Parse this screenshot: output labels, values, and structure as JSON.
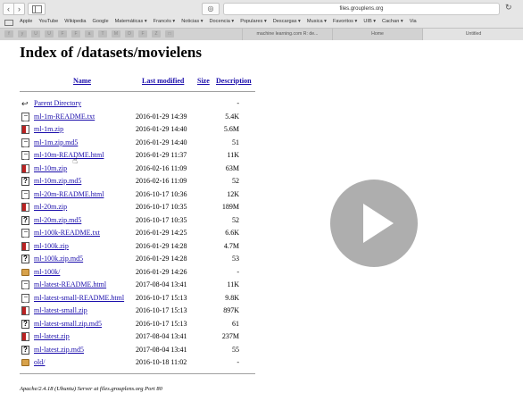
{
  "browser": {
    "address": "files.grouplens.org",
    "bookmarks": [
      "Apple",
      "YouTube",
      "Wikipedia",
      "Google",
      "Matemáticas ▾",
      "Francés ▾",
      "Noticias ▾",
      "Docencia ▾",
      "Populares ▾",
      "Descargas ▾",
      "Musica ▾",
      "Favoritos ▾",
      "UIB ▾",
      "Cachan ▾",
      "Via"
    ],
    "tab_icons": [
      "f",
      "y",
      "U",
      "U",
      "F",
      "F",
      "a",
      "T",
      "M",
      "D",
      "F",
      "Z",
      "□"
    ],
    "tabs": [
      "machine learning.com R: de...",
      "Home",
      "Untitled"
    ]
  },
  "page": {
    "title": "Index of /datasets/movielens",
    "columns": {
      "name": "Name",
      "last_modified": "Last modified",
      "size": "Size",
      "description": "Description"
    },
    "rows": [
      {
        "icon": "back",
        "name": "Parent Directory",
        "modified": "",
        "size": "-"
      },
      {
        "icon": "text",
        "name": "ml-1m-README.txt",
        "modified": "2016-01-29 14:39",
        "size": "5.4K"
      },
      {
        "icon": "zip",
        "name": "ml-1m.zip",
        "modified": "2016-01-29 14:40",
        "size": "5.6M"
      },
      {
        "icon": "text",
        "name": "ml-1m.zip.md5",
        "modified": "2016-01-29 14:40",
        "size": "51"
      },
      {
        "icon": "text",
        "name": "ml-10m-README.html",
        "modified": "2016-01-29 11:37",
        "size": "11K"
      },
      {
        "icon": "zip",
        "name": "ml-10m.zip",
        "modified": "2016-02-16 11:09",
        "size": "63M"
      },
      {
        "icon": "unknown",
        "name": "ml-10m.zip.md5",
        "modified": "2016-02-16 11:09",
        "size": "52"
      },
      {
        "icon": "text",
        "name": "ml-20m-README.html",
        "modified": "2016-10-17 10:36",
        "size": "12K"
      },
      {
        "icon": "zip",
        "name": "ml-20m.zip",
        "modified": "2016-10-17 10:35",
        "size": "189M"
      },
      {
        "icon": "unknown",
        "name": "ml-20m.zip.md5",
        "modified": "2016-10-17 10:35",
        "size": "52"
      },
      {
        "icon": "text",
        "name": "ml-100k-README.txt",
        "modified": "2016-01-29 14:25",
        "size": "6.6K"
      },
      {
        "icon": "zip",
        "name": "ml-100k.zip",
        "modified": "2016-01-29 14:28",
        "size": "4.7M"
      },
      {
        "icon": "unknown",
        "name": "ml-100k.zip.md5",
        "modified": "2016-01-29 14:28",
        "size": "53"
      },
      {
        "icon": "folder",
        "name": "ml-100k/",
        "modified": "2016-01-29 14:26",
        "size": "-"
      },
      {
        "icon": "text",
        "name": "ml-latest-README.html",
        "modified": "2017-08-04 13:41",
        "size": "11K"
      },
      {
        "icon": "text",
        "name": "ml-latest-small-README.html",
        "modified": "2016-10-17 15:13",
        "size": "9.8K"
      },
      {
        "icon": "zip",
        "name": "ml-latest-small.zip",
        "modified": "2016-10-17 15:13",
        "size": "897K"
      },
      {
        "icon": "unknown",
        "name": "ml-latest-small.zip.md5",
        "modified": "2016-10-17 15:13",
        "size": "61"
      },
      {
        "icon": "zip",
        "name": "ml-latest.zip",
        "modified": "2017-08-04 13:41",
        "size": "237M"
      },
      {
        "icon": "unknown",
        "name": "ml-latest.zip.md5",
        "modified": "2017-08-04 13:41",
        "size": "55"
      },
      {
        "icon": "folder",
        "name": "old/",
        "modified": "2016-10-18 11:02",
        "size": "-"
      }
    ],
    "footer": "Apache/2.4.18 (Ubuntu) Server at files.grouplens.org Port 80"
  }
}
